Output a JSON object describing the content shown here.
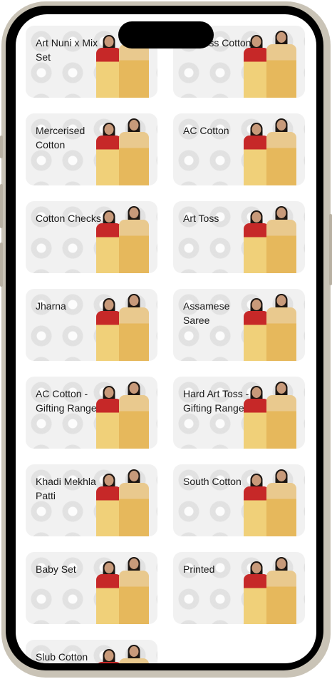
{
  "categories": [
    {
      "label": "Art Nuni x Mix Set"
    },
    {
      "label": "Art Toss Cotton"
    },
    {
      "label": "Mercerised Cotton"
    },
    {
      "label": "AC Cotton"
    },
    {
      "label": "Cotton Checks"
    },
    {
      "label": "Art Toss"
    },
    {
      "label": "Jharna"
    },
    {
      "label": "Assamese Saree"
    },
    {
      "label": "AC Cotton - Gifting Range"
    },
    {
      "label": "Hard Art Toss - Gifting Range"
    },
    {
      "label": "Khadi Mekhla Patti"
    },
    {
      "label": "South Cotton"
    },
    {
      "label": "Baby Set"
    },
    {
      "label": "Printed"
    },
    {
      "label": "Slub Cotton"
    }
  ],
  "colors": {
    "card_background": "#f1f1f1",
    "label": "#1a1a1a",
    "saree_red": "#c62828",
    "saree_gold": "#e6b85c"
  }
}
